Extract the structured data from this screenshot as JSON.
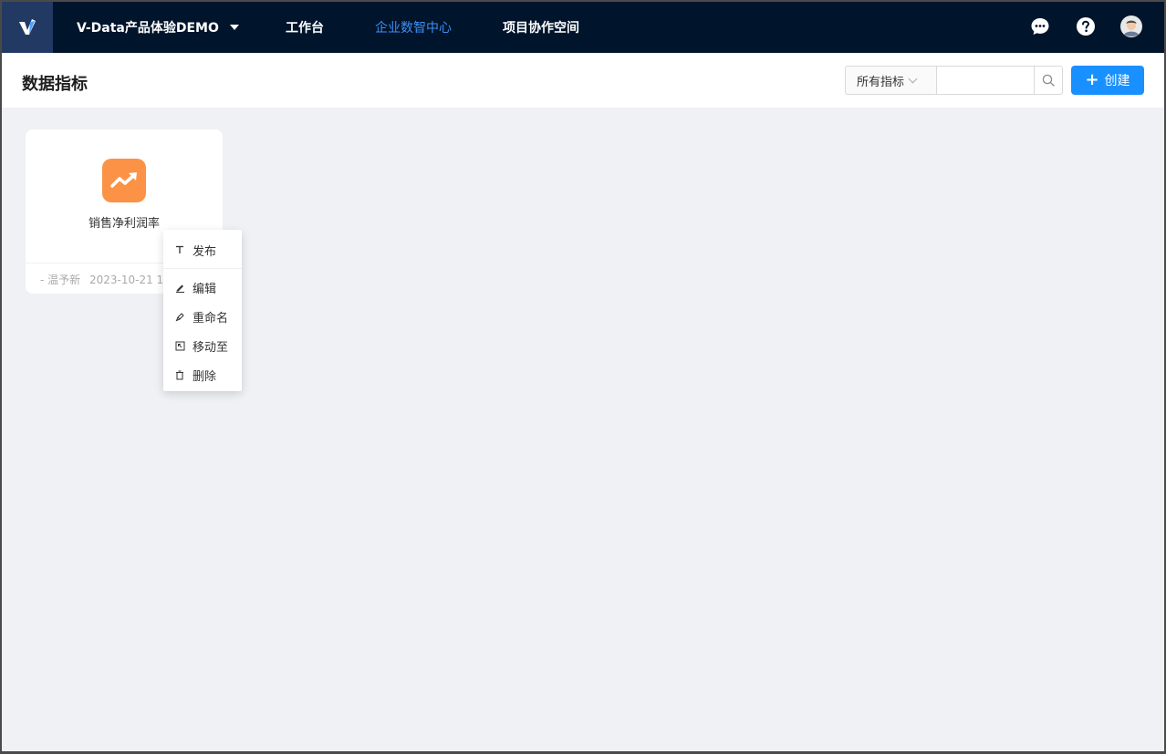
{
  "topbar": {
    "app_name": "V-Data产品体验DEMO",
    "nav": [
      {
        "label": "工作台"
      },
      {
        "label": "企业数智中心"
      },
      {
        "label": "项目协作空间"
      }
    ]
  },
  "colors": {
    "topbar_bg": "#00142b",
    "active_nav": "#3d8ff5",
    "primary": "#1890ff",
    "metric_icon": "#fb9246"
  },
  "header": {
    "title": "数据指标",
    "filter_selected": "所有指标",
    "search_value": "",
    "create_label": "创建"
  },
  "card": {
    "name": "销售净利润率",
    "owner": "- 温予新",
    "time": "2023-10-21 10:30"
  },
  "context_menu": {
    "items": [
      {
        "label": "发布",
        "icon": "publish-icon"
      },
      {
        "label": "编辑",
        "icon": "edit-icon"
      },
      {
        "label": "重命名",
        "icon": "rename-icon"
      },
      {
        "label": "移动至",
        "icon": "move-icon"
      },
      {
        "label": "删除",
        "icon": "delete-icon"
      }
    ]
  }
}
